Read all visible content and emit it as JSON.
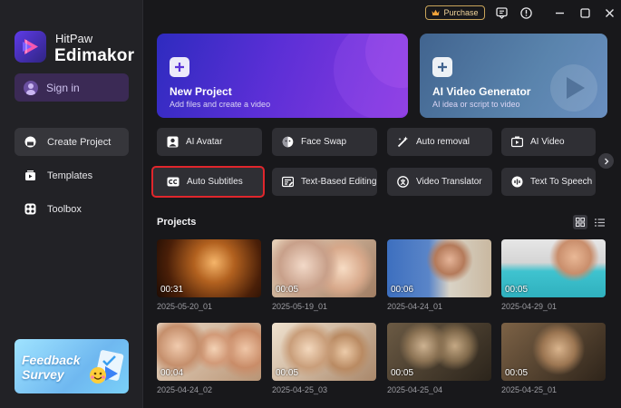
{
  "titlebar": {
    "purchase_label": "Purchase",
    "icons": [
      "crown-icon",
      "feedback-icon",
      "info-icon",
      "minimize-icon",
      "maximize-icon",
      "close-icon"
    ]
  },
  "sidebar": {
    "brand_top": "HitPaw",
    "brand_main": "Edimakor",
    "signin_label": "Sign in",
    "nav": [
      {
        "label": "Create Project",
        "icon": "create-project-icon",
        "active": true
      },
      {
        "label": "Templates",
        "icon": "templates-icon",
        "active": false
      },
      {
        "label": "Toolbox",
        "icon": "toolbox-icon",
        "active": false
      }
    ],
    "feedback": {
      "line1": "Feedback",
      "line2": "Survey"
    }
  },
  "cards": {
    "new_project": {
      "title": "New Project",
      "subtitle": "Add files and create a video"
    },
    "ai_video_generator": {
      "title": "AI Video Generator",
      "subtitle": "AI idea or script to video"
    }
  },
  "tools": [
    {
      "label": "AI Avatar",
      "icon": "avatar-icon"
    },
    {
      "label": "Face Swap",
      "icon": "face-swap-icon"
    },
    {
      "label": "Auto removal",
      "icon": "magic-wand-icon"
    },
    {
      "label": "AI Video",
      "icon": "ai-video-icon"
    },
    {
      "label": "Auto Subtitles",
      "icon": "cc-icon",
      "highlighted": true
    },
    {
      "label": "Text-Based Editing",
      "icon": "text-edit-icon"
    },
    {
      "label": "Video Translator",
      "icon": "translate-icon"
    },
    {
      "label": "Text To Speech",
      "icon": "speech-icon"
    }
  ],
  "projects": {
    "heading": "Projects",
    "items": [
      {
        "name": "2025-05-20_01",
        "duration": "00:31"
      },
      {
        "name": "2025-05-19_01",
        "duration": "00:05"
      },
      {
        "name": "2025-04-24_01",
        "duration": "00:06"
      },
      {
        "name": "2025-04-29_01",
        "duration": "00:05"
      },
      {
        "name": "2025-04-24_02",
        "duration": "00:04"
      },
      {
        "name": "2025-04-25_03",
        "duration": "00:05"
      },
      {
        "name": "2025-04-25_04",
        "duration": "00:05"
      },
      {
        "name": "2025-04-25_01",
        "duration": "00:05"
      }
    ]
  }
}
